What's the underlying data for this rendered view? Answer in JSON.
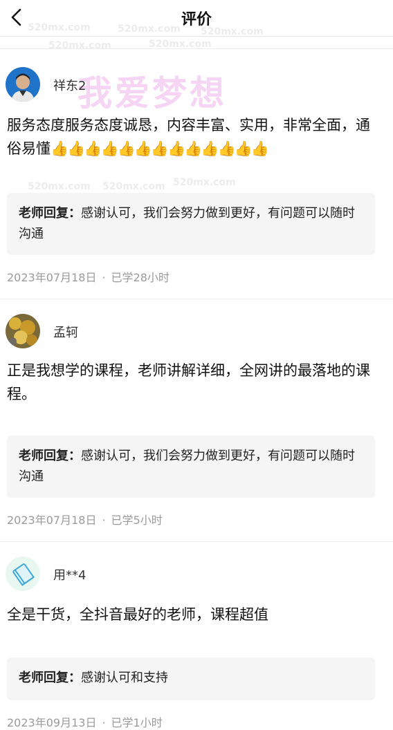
{
  "header": {
    "title": "评价"
  },
  "watermark": {
    "text_large": "我爱梦想",
    "text_small": "520mx.com"
  },
  "reviews": [
    {
      "username": "祥东2",
      "content": "服务态度服务态度诚恳，内容丰富、实用，非常全面，通俗易懂",
      "emoji": "👍👍👍👍👍👍👍👍👍👍👍👍👍",
      "reply_label": "老师回复：",
      "reply_text": "感谢认可，我们会努力做到更好，有问题可以随时沟通",
      "date": "2023年07月18日",
      "study": "已学28小时"
    },
    {
      "username": "孟轲",
      "content": "正是我想学的课程，老师讲解详细，全网讲的最落地的课程。",
      "reply_label": "老师回复：",
      "reply_text": "感谢认可，我们会努力做到更好，有问题可以随时沟通",
      "date": "2023年07月18日",
      "study": "已学5小时"
    },
    {
      "username": "用**4",
      "content": "全是干货，全抖音最好的老师，课程超值",
      "reply_label": "老师回复：",
      "reply_text": "感谢认可和支持",
      "date": "2023年09月13日",
      "study": "已学1小时"
    }
  ],
  "separator": "·"
}
